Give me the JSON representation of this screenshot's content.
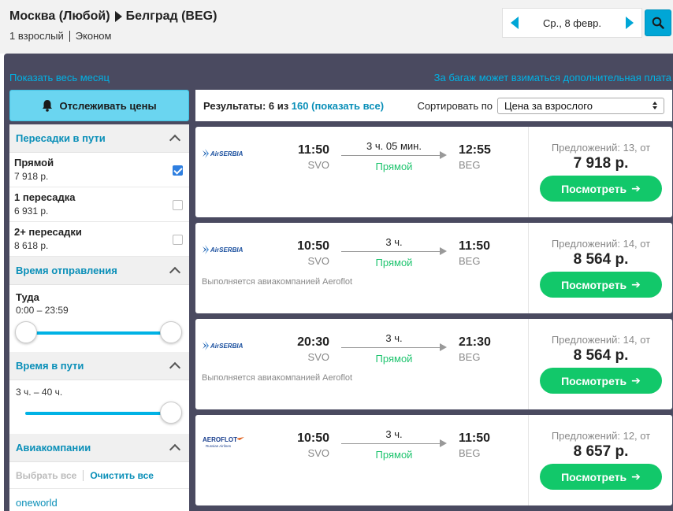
{
  "header": {
    "origin": "Москва (Любой)",
    "destination": "Белград (BEG)",
    "passengers": "1 взрослый",
    "cabin": "Эконом",
    "date": "Ср., 8 февр."
  },
  "links": {
    "whole_month": "Показать весь месяц",
    "baggage": "За багаж может взиматься дополнительная плата"
  },
  "sidebar": {
    "track_prices": "Отслеживать цены",
    "stops": {
      "title": "Пересадки в пути",
      "options": [
        {
          "label": "Прямой",
          "price": "7 918 р.",
          "checked": true
        },
        {
          "label": "1 пересадка",
          "price": "6 931 р.",
          "checked": false
        },
        {
          "label": "2+ пересадки",
          "price": "8 618 р.",
          "checked": false
        }
      ]
    },
    "departure": {
      "title": "Время отправления",
      "direction": "Туда",
      "range": "0:00 – 23:59"
    },
    "duration": {
      "title": "Время в пути",
      "range": "3 ч. – 40 ч."
    },
    "airlines": {
      "title": "Авиакомпании",
      "select_all": "Выбрать все",
      "clear_all": "Очистить все",
      "alliance": "oneworld"
    }
  },
  "results_header": {
    "prefix": "Результаты: 6 из ",
    "total": "160",
    "show_all": " (показать все)",
    "sort_label": "Сортировать по",
    "sort_value": "Цена за взрослого"
  },
  "results": [
    {
      "airline": "AirSERBIA",
      "dep_time": "11:50",
      "dep_code": "SVO",
      "duration": "3 ч. 05 мин.",
      "stop_type": "Прямой",
      "arr_time": "12:55",
      "arr_code": "BEG",
      "operated_by": "",
      "offers": "Предложений: 13, от",
      "price": "7 918 р.",
      "button": "Посмотреть"
    },
    {
      "airline": "AirSERBIA",
      "dep_time": "10:50",
      "dep_code": "SVO",
      "duration": "3 ч.",
      "stop_type": "Прямой",
      "arr_time": "11:50",
      "arr_code": "BEG",
      "operated_by": "Выполняется авиакомпанией Aeroflot",
      "offers": "Предложений: 14, от",
      "price": "8 564 р.",
      "button": "Посмотреть"
    },
    {
      "airline": "AirSERBIA",
      "dep_time": "20:30",
      "dep_code": "SVO",
      "duration": "3 ч.",
      "stop_type": "Прямой",
      "arr_time": "21:30",
      "arr_code": "BEG",
      "operated_by": "Выполняется авиакомпанией Aeroflot",
      "offers": "Предложений: 14, от",
      "price": "8 564 р.",
      "button": "Посмотреть"
    },
    {
      "airline": "AEROFLOT",
      "airline_sub": "Russian Airlines",
      "dep_time": "10:50",
      "dep_code": "SVO",
      "duration": "3 ч.",
      "stop_type": "Прямой",
      "arr_time": "11:50",
      "arr_code": "BEG",
      "operated_by": "",
      "offers": "Предложений: 12, от",
      "price": "8 657 р.",
      "button": "Посмотреть"
    }
  ],
  "colors": {
    "accent": "#00a6d6",
    "panel": "#4a4a60",
    "green": "#12c86a",
    "link": "#0a8fb8"
  }
}
